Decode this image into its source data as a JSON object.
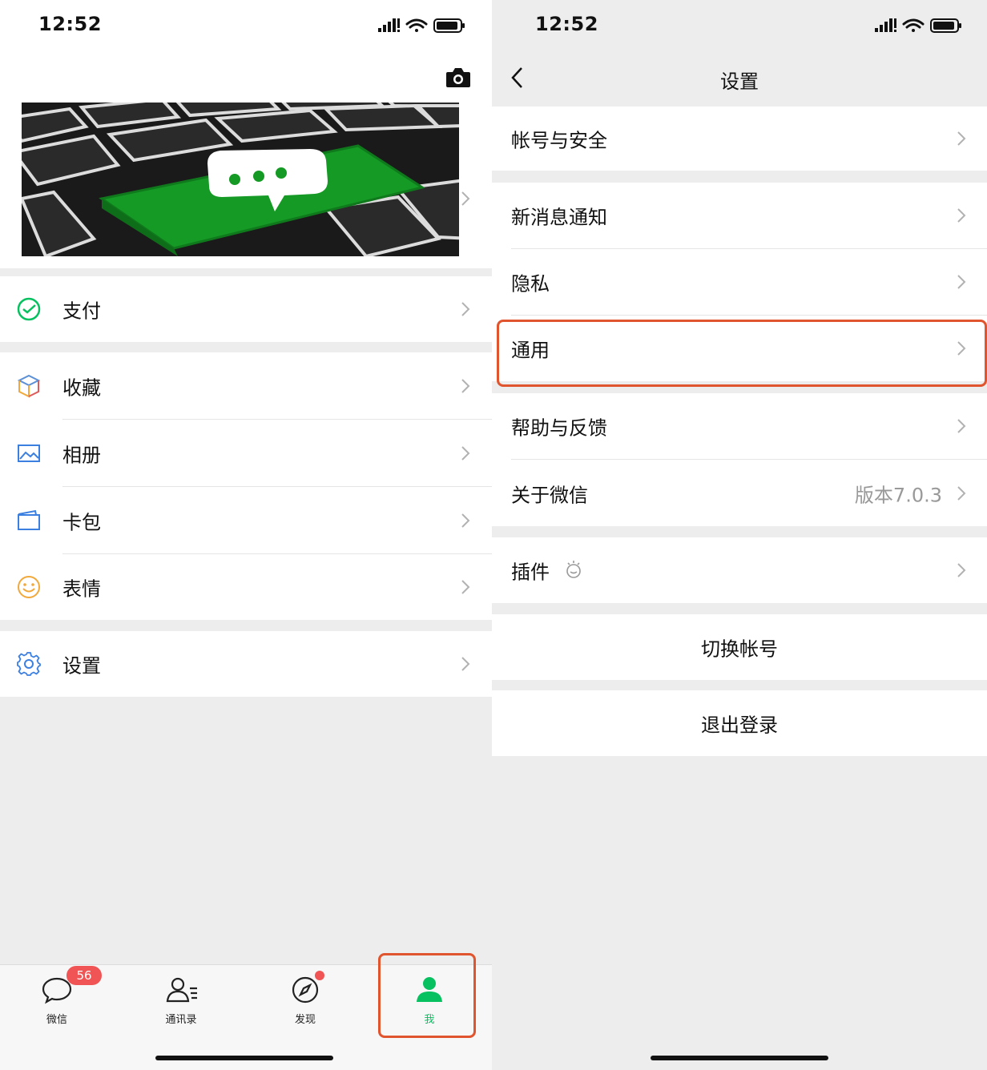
{
  "left": {
    "status": {
      "time": "12:52"
    },
    "menu": [
      {
        "key": "pay",
        "label": "支付",
        "icon": "wechat-pay-icon"
      },
      {
        "key": "favorites",
        "label": "收藏",
        "icon": "cube-icon"
      },
      {
        "key": "album",
        "label": "相册",
        "icon": "photo-album-icon"
      },
      {
        "key": "cards",
        "label": "卡包",
        "icon": "card-wallet-icon"
      },
      {
        "key": "stickers",
        "label": "表情",
        "icon": "smiley-icon"
      },
      {
        "key": "settings",
        "label": "设置",
        "icon": "gear-icon"
      }
    ],
    "tabbar": {
      "chats": {
        "label": "微信",
        "badge": "56",
        "icon": "chat-bubble-icon"
      },
      "contacts": {
        "label": "通讯录",
        "icon": "contacts-icon"
      },
      "discover": {
        "label": "发现",
        "icon": "compass-icon"
      },
      "me": {
        "label": "我",
        "icon": "person-icon"
      }
    }
  },
  "right": {
    "status": {
      "time": "12:52"
    },
    "nav": {
      "title": "设置"
    },
    "items": {
      "account_security": "帐号与安全",
      "notifications": "新消息通知",
      "privacy": "隐私",
      "general": "通用",
      "help_feedback": "帮助与反馈",
      "about": "关于微信",
      "about_version": "版本7.0.3",
      "plugins": "插件"
    },
    "actions": {
      "switch_account": "切换帐号",
      "logout": "退出登录"
    }
  },
  "colors": {
    "wechat_green": "#07c160",
    "highlight_border": "#e0552e",
    "badge_red": "#f05454",
    "background": "#ededed"
  }
}
